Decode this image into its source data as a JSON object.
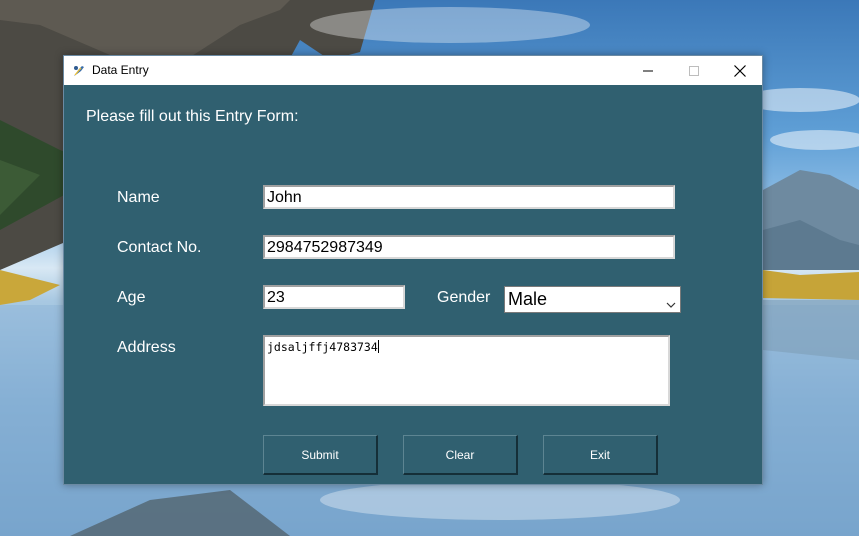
{
  "window": {
    "title": "Data Entry"
  },
  "form": {
    "heading": "Please fill out this Entry Form:",
    "name_label": "Name",
    "name_value": "John",
    "contact_label": "Contact No.",
    "contact_value": "2984752987349",
    "age_label": "Age",
    "age_value": "23",
    "gender_label": "Gender",
    "gender_value": "Male",
    "address_label": "Address",
    "address_value": "jdsaljffj4783734"
  },
  "buttons": {
    "submit": "Submit",
    "clear": "Clear",
    "exit": "Exit"
  },
  "icons": {
    "app": "feather-app-icon",
    "minimize": "minimize-icon",
    "maximize": "maximize-icon",
    "close": "close-icon",
    "dropdown": "chevron-down-icon"
  },
  "colors": {
    "form_background": "#306070",
    "label_text": "#ffffff"
  }
}
